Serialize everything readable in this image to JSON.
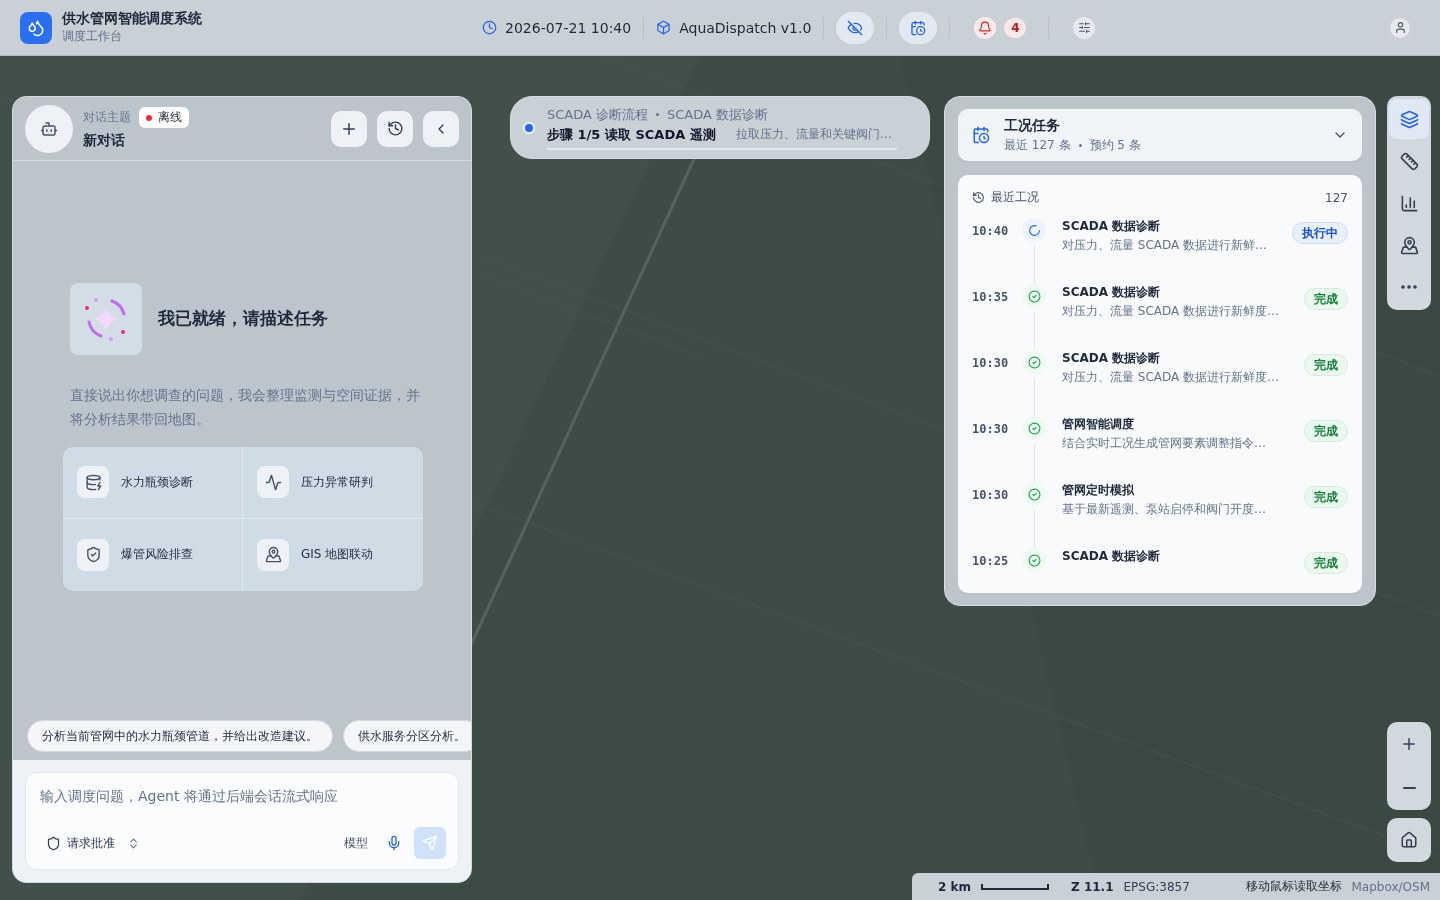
{
  "header": {
    "app_title": "供水管网智能调度系统",
    "app_subtitle": "调度工作台",
    "datetime": "2026-07-21 10:40",
    "version": "AquaDispatch v1.0",
    "toggles": [
      {
        "kind": "visibility",
        "on": true
      },
      {
        "kind": "schedule",
        "on": true
      }
    ],
    "notification_count": "4"
  },
  "chat": {
    "topic_label": "对话主题",
    "topic": "新对话",
    "status": {
      "label": "离线",
      "online": false
    },
    "welcome_title": "我已就绪，请描述任务",
    "welcome_text": "直接说出你想调查的问题，我会整理监测与空间证据，并将分析结果带回地图。",
    "quick_actions": [
      {
        "kind": "database",
        "label": "水力瓶颈诊断"
      },
      {
        "kind": "pulse",
        "label": "压力异常研判"
      },
      {
        "kind": "shield",
        "label": "爆管风险排查"
      },
      {
        "kind": "map",
        "label": "GIS 地图联动"
      }
    ],
    "suggestions": [
      "分析当前管网中的水力瓶颈管道，并给出改造建议。",
      "供水服务分区分析。"
    ],
    "input": {
      "placeholder": "输入调度问题，Agent 将通过后端会话流式响应"
    },
    "approval": "请求批准",
    "model": "模型"
  },
  "workflow": {
    "flow": "SCADA 诊断流程",
    "task": "SCADA 数据诊断",
    "step": "步骤 1/5 读取 SCADA 遥测",
    "step_detail": "拉取压力、流量和关键阀门…"
  },
  "tasks": {
    "title": "工况任务",
    "recent_total": "最近 127 条",
    "scheduled": "预约 5 条",
    "expanded": true,
    "section_label": "最近工况",
    "section_count": "127",
    "items": [
      {
        "time": "10:40",
        "title": "SCADA 数据诊断",
        "description": "对压力、流量 SCADA 数据进行新鲜…",
        "status": "执行中",
        "kind": "running"
      },
      {
        "time": "10:35",
        "title": "SCADA 数据诊断",
        "description": "对压力、流量 SCADA 数据进行新鲜度…",
        "status": "完成",
        "kind": "done"
      },
      {
        "time": "10:30",
        "title": "SCADA 数据诊断",
        "description": "对压力、流量 SCADA 数据进行新鲜度…",
        "status": "完成",
        "kind": "done"
      },
      {
        "time": "10:30",
        "title": "管网智能调度",
        "description": "结合实时工况生成管网要素调整指令…",
        "status": "完成",
        "kind": "done"
      },
      {
        "time": "10:30",
        "title": "管网定时模拟",
        "description": "基于最新遥测、泵站启停和阀门开度…",
        "status": "完成",
        "kind": "done"
      },
      {
        "time": "10:25",
        "title": "SCADA 数据诊断",
        "status": "完成",
        "kind": "done"
      }
    ]
  },
  "map_tools": [
    {
      "kind": "layers",
      "selected": true
    },
    {
      "kind": "ruler",
      "selected": false
    },
    {
      "kind": "chart",
      "selected": false
    },
    {
      "kind": "locate",
      "selected": false
    },
    {
      "kind": "more",
      "selected": false
    }
  ],
  "status_bar": {
    "scale": "2 km",
    "zoom": "Z 11.1",
    "crs": "EPSG:3857",
    "hint": "移动鼠标读取坐标",
    "attribution": "Mapbox/OSM"
  }
}
